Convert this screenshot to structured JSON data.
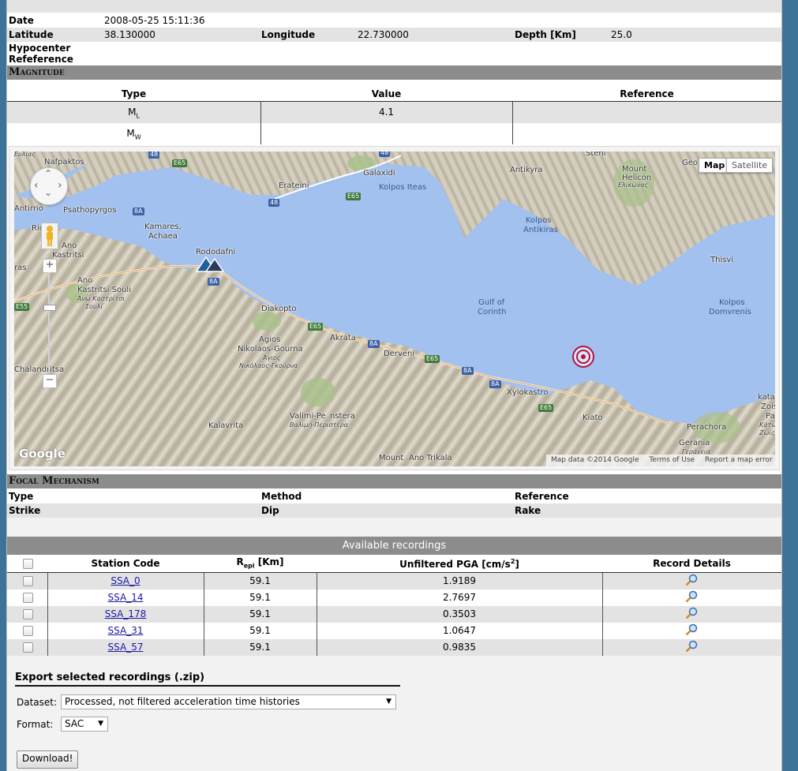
{
  "event": {
    "date_label": "Date",
    "date_value": "2008-05-25 15:11:36",
    "latitude_label": "Latitude",
    "latitude_value": "38.130000",
    "longitude_label": "Longitude",
    "longitude_value": "22.730000",
    "depth_label": "Depth [Km]",
    "depth_value": "25.0",
    "hypocenter_label_1": "Hypocenter",
    "hypocenter_label_2": "Refeference"
  },
  "magnitude": {
    "section_title": "Magnitude",
    "col_type": "Type",
    "col_value": "Value",
    "col_reference": "Reference",
    "rows": [
      {
        "type": "M",
        "sub": "L",
        "value": "4.1",
        "reference": ""
      },
      {
        "type": "M",
        "sub": "W",
        "value": "",
        "reference": ""
      }
    ]
  },
  "map": {
    "btn_map": "Map",
    "btn_satellite": "Satellite",
    "attribution": "Map data ©2014 Google",
    "terms": "Terms of Use",
    "report": "Report a map error",
    "logo": "Google",
    "zoom_in": "+",
    "zoom_out": "−",
    "labels": {
      "nafpaktos": "Nafpaktos",
      "galaxidi": "Galaxidi",
      "antikyra": "Antikyra",
      "geo": "Geo",
      "mount_helicon": "Mount",
      "helicon": "Helicon",
      "helicon_gr": "Ελικώνας",
      "erateini": "Erateini",
      "kolpos_iteas": "Kolpos Iteas",
      "antirrio": "Antirrio",
      "psathopyrgos": "Psathopyrgos",
      "kamares": "Kamares,",
      "achaea": "Achaea",
      "kolpos_ant_1": "Kolpos",
      "kolpos_ant_2": "Antikiras",
      "rio": "Rio",
      "ano_kastritsi": "Ano",
      "kastritsi": "Kastritsi",
      "rododafni": "Rododafni",
      "thisvi": "Thisvi",
      "ras": "ras",
      "ano2": "Ano",
      "kastritsi_souli": "Kastritsi Souli",
      "kastritsi_gr": "Άνω Καστρίτσι",
      "souli_gr": "Σουλί",
      "gulf_1": "Gulf of",
      "gulf_2": "Corinth",
      "diakopto": "Diakopto",
      "kolpos_dom_1": "Kolpos",
      "kolpos_dom_2": "Domvrenis",
      "akrata": "Akrata",
      "agios": "Agios",
      "nikolaos_gourna": "Nikolaos-Gourna",
      "agios_gr": "Άγιος",
      "nikolaos_gr": "Νικόλαος-Γκούρνα",
      "derveni": "Derveni",
      "chalandritsa": "Chalandritsa",
      "xylokastro": "Xylokastro",
      "katat": "katat",
      "zois": "Zois",
      "pa": "Pa",
      "katw": "Κάτω",
      "zwis": "Ζωίς",
      "valimi": "Valimi-Pe",
      "nstera": "nstera",
      "valimi_gr": "Βαλιμή-Περιστέρα",
      "kalavrita": "Kalavrita",
      "kiato": "Kiato",
      "perachora": "Perachora",
      "gerania": "Gerania",
      "gerania_gr": "Γεράνεια",
      "mount": "Mount",
      "ano_trikala": "Ano Trikala",
      "evlias": "Ευλίας",
      "steni": "Steni"
    },
    "shields": {
      "e65": "E65",
      "r48": "48",
      "r8a": "8A",
      "e55": "E55"
    }
  },
  "focal": {
    "section_title": "Focal Mechanism",
    "type": "Type",
    "method": "Method",
    "reference": "Reference",
    "strike": "Strike",
    "dip": "Dip",
    "rake": "Rake"
  },
  "recordings": {
    "title": "Available recordings",
    "col_station": "Station Code",
    "col_repi": "R",
    "col_repi_sub": "epi",
    "col_repi_unit": " [Km]",
    "col_pga": "Unfiltered PGA [cm/s",
    "col_pga_sup": "2",
    "col_pga_end": "]",
    "col_details": "Record Details",
    "rows": [
      {
        "station": "SSA_0",
        "repi": "59.1",
        "pga": "1.9189"
      },
      {
        "station": "SSA_14",
        "repi": "59.1",
        "pga": "2.7697"
      },
      {
        "station": "SSA_178",
        "repi": "59.1",
        "pga": "0.3503"
      },
      {
        "station": "SSA_31",
        "repi": "59.1",
        "pga": "1.0647"
      },
      {
        "station": "SSA_57",
        "repi": "59.1",
        "pga": "0.9835"
      }
    ]
  },
  "export": {
    "title": "Export selected recordings (.zip)",
    "dataset_label": "Dataset:",
    "dataset_value": "Processed, not filtered acceleration time histories",
    "format_label": "Format:",
    "format_value": "SAC",
    "download": "Download!"
  },
  "colors": {
    "page_bg": "#3d7396",
    "section_bar": "#8c8c8c",
    "row_grey": "#e3e3e3",
    "link": "#1a1aa6",
    "sea": "#a3c1ee",
    "epicenter": "#b0123e"
  }
}
